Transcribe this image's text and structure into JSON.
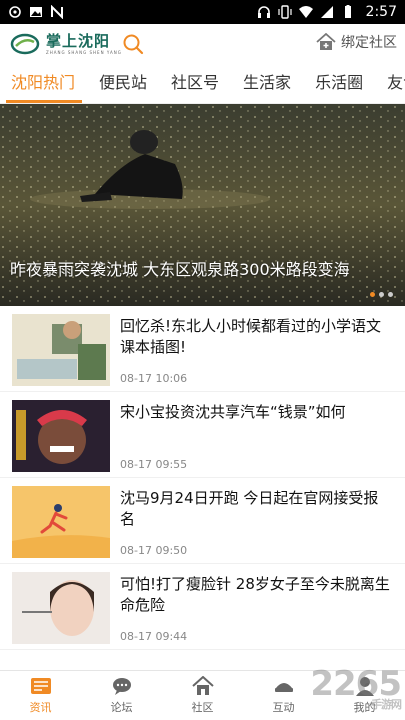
{
  "status_bar": {
    "time": "2:57",
    "left_icons": [
      "sync-icon",
      "image-icon",
      "n-icon"
    ],
    "right_icons": [
      "headphones-icon",
      "vibrate-icon",
      "wifi-icon",
      "signal-icon",
      "battery-icon"
    ]
  },
  "header": {
    "logo_text": "掌上沈阳",
    "logo_subtext": "ZHANG SHANG SHEN YANG",
    "bind_label": "绑定社区",
    "accent": "#f08a24"
  },
  "tabs": [
    {
      "label": "沈阳热门",
      "active": true
    },
    {
      "label": "便民站",
      "active": false
    },
    {
      "label": "社区号",
      "active": false
    },
    {
      "label": "生活家",
      "active": false
    },
    {
      "label": "乐活圈",
      "active": false
    },
    {
      "label": "友邻",
      "active": false
    }
  ],
  "hero": {
    "caption": "昨夜暴雨突袭沈城 大东区观泉路300米路段变海",
    "slide_count": 3,
    "active_slide": 1
  },
  "news": [
    {
      "title": "回忆杀!东北人小时候都看过的小学语文课本插图!",
      "time": "08-17 10:06"
    },
    {
      "title": "宋小宝投资沈共享汽车“钱景”如何",
      "time": "08-17 09:55"
    },
    {
      "title": "沈马9月24日开跑 今日起在官网接受报名",
      "time": "08-17 09:50"
    },
    {
      "title": "可怕!打了瘦脸针 28岁女子至今未脱离生命危险",
      "time": "08-17 09:44"
    }
  ],
  "bottom_nav": [
    {
      "label": "资讯",
      "icon": "news-icon",
      "active": true
    },
    {
      "label": "论坛",
      "icon": "chat-icon",
      "active": false
    },
    {
      "label": "社区",
      "icon": "home-icon",
      "active": false
    },
    {
      "label": "互动",
      "icon": "interact-icon",
      "active": false
    },
    {
      "label": "我的",
      "icon": "user-icon",
      "active": false
    }
  ],
  "watermark": {
    "big": "2265",
    "small": "手游网"
  }
}
